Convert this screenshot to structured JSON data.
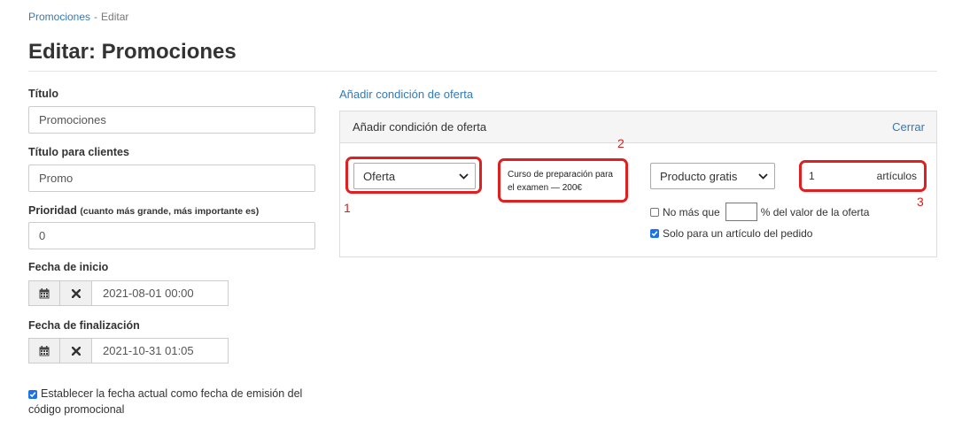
{
  "breadcrumb": {
    "link": "Promociones",
    "separator": "-",
    "current": "Editar"
  },
  "page": {
    "title": "Editar: Promociones"
  },
  "form": {
    "title_label": "Título",
    "title_value": "Promociones",
    "client_title_label": "Título para clientes",
    "client_title_value": "Promo",
    "priority_label": "Prioridad",
    "priority_hint": "(cuanto más grande, más importante es)",
    "priority_value": "0",
    "start_label": "Fecha de inicio",
    "start_value": "2021-08-01 00:00",
    "end_label": "Fecha de finalización",
    "end_value": "2021-10-31 01:05",
    "set_date_label": "Establecer la fecha actual como fecha de emisión del código promocional"
  },
  "offer": {
    "add_link": "Añadir condición de oferta",
    "panel_title": "Añadir condición de oferta",
    "close": "Cerrar",
    "type_select": "Oferta",
    "product_label": "Curso de preparación para el examen — 200€",
    "reward_select": "Producto gratis",
    "quantity": "1",
    "quantity_unit": "artículos",
    "no_more_prefix": "No más que",
    "no_more_suffix": "% del valor de la oferta",
    "only_one_label": "Solo para un artículo del pedido"
  },
  "annotations": {
    "one": "1",
    "two": "2",
    "three": "3"
  },
  "colors": {
    "accent": "#337ab7",
    "highlight": "#e02020",
    "checkbox": "#1a73e8"
  },
  "icons": {
    "calendar": "calendar-icon",
    "clear": "times-icon",
    "chevron": "chevron-down-icon",
    "check": "check-icon"
  }
}
